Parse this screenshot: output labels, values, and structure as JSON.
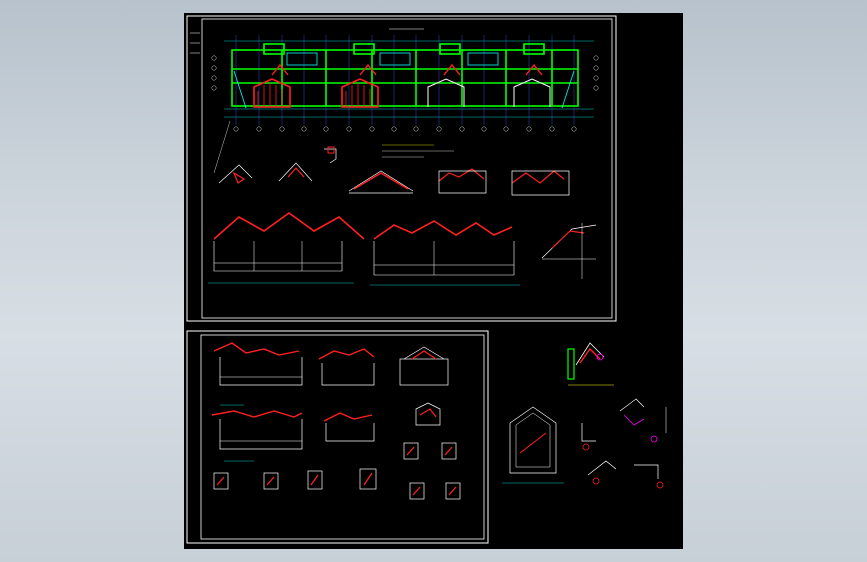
{
  "viewer": {
    "background_top": "#b7c2cc",
    "background_mid": "#d7dee4",
    "canvas_color": "#000000"
  },
  "sheets": [
    {
      "id": "sheet-1",
      "caption": "",
      "contents": [
        "plan",
        "sections",
        "details"
      ]
    },
    {
      "id": "sheet-2",
      "caption": "",
      "contents": [
        "sections",
        "details"
      ]
    }
  ],
  "colors": {
    "frame": "#ffffff",
    "wall": "#00ff00",
    "hatch": "#ff2020",
    "dimension": "#00ffff",
    "text": "#ffffff",
    "annotation": "#ffff00",
    "accent": "#ff00ff",
    "grid": "#3c5cff"
  }
}
